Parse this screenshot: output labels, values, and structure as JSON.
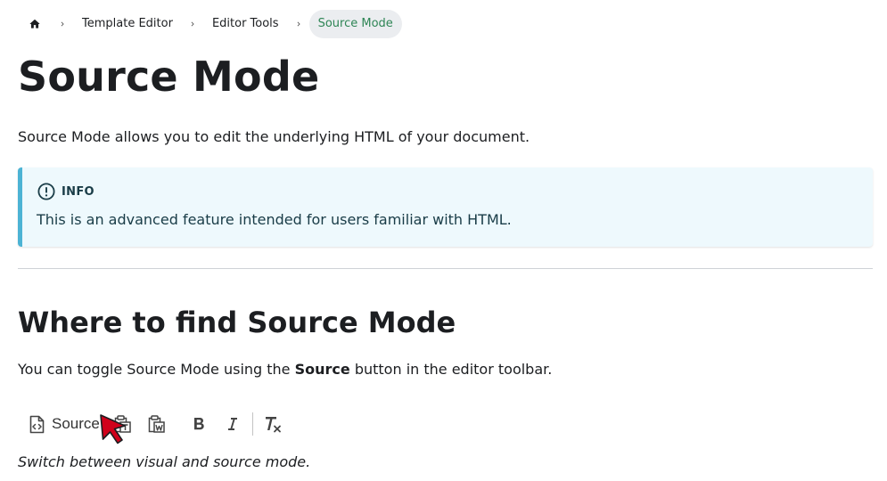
{
  "breadcrumb": {
    "items": [
      "Template Editor",
      "Editor Tools"
    ],
    "current": "Source Mode"
  },
  "page": {
    "title": "Source Mode",
    "intro": "Source Mode allows you to edit the underlying HTML of your document."
  },
  "info": {
    "label": "INFO",
    "text": "This is an advanced feature intended for users familiar with HTML."
  },
  "section": {
    "heading": "Where to find Source Mode",
    "text_before": "You can toggle Source Mode using the ",
    "text_bold": "Source",
    "text_after": " button in the editor toolbar.",
    "caption": "Switch between visual and source mode."
  },
  "toolbar": {
    "source_label": "Source",
    "icons": [
      "source-icon",
      "paste-text-icon",
      "paste-word-icon",
      "bold-icon",
      "italic-icon",
      "remove-format-icon"
    ]
  },
  "colors": {
    "accent": "#2e8555",
    "info_border": "#4cb3d4",
    "info_bg": "#eef9fd",
    "cursor": "#d0021b"
  }
}
